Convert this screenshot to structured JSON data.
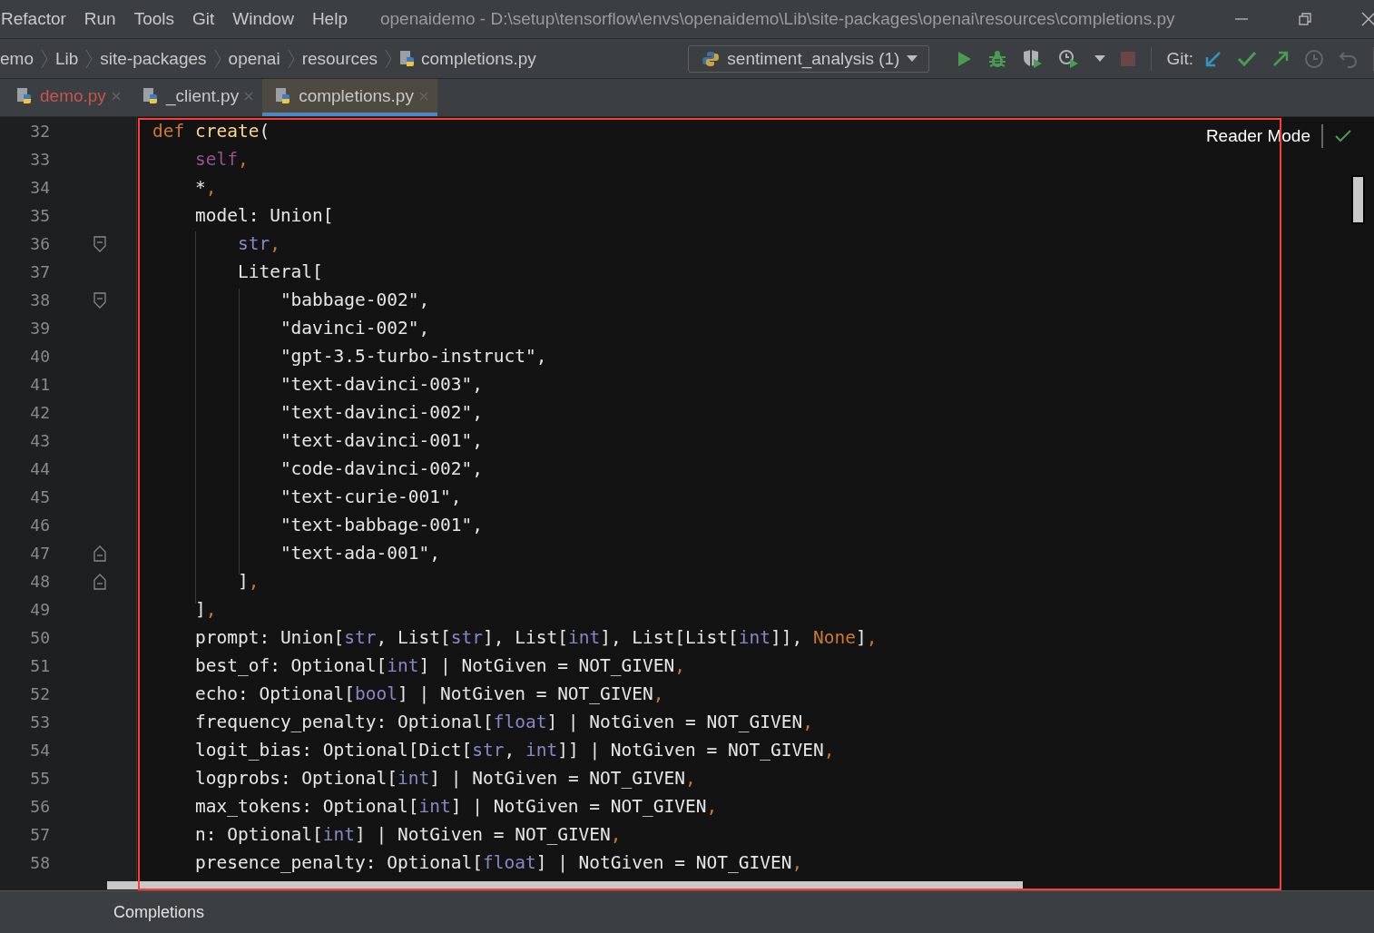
{
  "menu": [
    "Refactor",
    "Run",
    "Tools",
    "Git",
    "Window",
    "Help"
  ],
  "window": {
    "title": "openaidemo - D:\\setup\\tensorflow\\envs\\openaidemo\\Lib\\site-packages\\openai\\resources\\completions.py"
  },
  "breadcrumbs": [
    "emo",
    "Lib",
    "site-packages",
    "openai",
    "resources",
    "completions.py"
  ],
  "run_config": "sentiment_analysis (1)",
  "toolbar": [
    {
      "kind": "run",
      "disabled": false
    },
    {
      "kind": "debug",
      "disabled": false
    },
    {
      "kind": "coverage",
      "disabled": false
    },
    {
      "kind": "profile",
      "disabled": false
    },
    {
      "kind": "stop",
      "disabled": true
    }
  ],
  "git": {
    "label": "Git:",
    "buttons": [
      {
        "kind": "update",
        "disabled": false
      },
      {
        "kind": "commit",
        "disabled": false
      },
      {
        "kind": "push",
        "disabled": false
      },
      {
        "kind": "history",
        "disabled": true
      },
      {
        "kind": "rollback",
        "disabled": true
      }
    ]
  },
  "tabs": [
    {
      "label": "demo.py",
      "selected": false,
      "has_errors": true
    },
    {
      "label": "_client.py",
      "selected": false,
      "has_errors": false
    },
    {
      "label": "completions.py",
      "selected": true,
      "has_errors": false
    }
  ],
  "reader_mode": "Reader Mode",
  "lines": [
    {
      "n": "32",
      "fold_start": false,
      "fold_end": false,
      "tokens": [
        {
          "kind": "kw",
          "text": "def"
        },
        {
          "kind": "fn",
          "text": " create"
        },
        {
          "kind": "p",
          "text": "("
        }
      ]
    },
    {
      "n": "33",
      "fold_start": false,
      "fold_end": false,
      "tokens": [
        {
          "kind": "self",
          "text": "    self"
        },
        {
          "kind": "kw",
          "text": ","
        }
      ]
    },
    {
      "n": "34",
      "fold_start": false,
      "fold_end": false,
      "tokens": [
        {
          "kind": "p",
          "text": "    *"
        },
        {
          "kind": "kw",
          "text": ","
        }
      ]
    },
    {
      "n": "35",
      "fold_start": false,
      "fold_end": false,
      "tokens": [
        {
          "kind": "p",
          "text": "    model: Union["
        }
      ]
    },
    {
      "n": "36",
      "fold_start": true,
      "fold_end": false,
      "tokens": [
        {
          "kind": "bi",
          "text": "        str"
        },
        {
          "kind": "kw",
          "text": ","
        }
      ]
    },
    {
      "n": "37",
      "fold_start": false,
      "fold_end": false,
      "tokens": [
        {
          "kind": "p",
          "text": "        Literal["
        }
      ]
    },
    {
      "n": "38",
      "fold_start": true,
      "fold_end": false,
      "tokens": [
        {
          "kind": "p",
          "text": "            \"babbage-002\","
        }
      ]
    },
    {
      "n": "39",
      "fold_start": false,
      "fold_end": false,
      "tokens": [
        {
          "kind": "p",
          "text": "            \"davinci-002\","
        }
      ]
    },
    {
      "n": "40",
      "fold_start": false,
      "fold_end": false,
      "tokens": [
        {
          "kind": "p",
          "text": "            \"gpt-3.5-turbo-instruct\","
        }
      ]
    },
    {
      "n": "41",
      "fold_start": false,
      "fold_end": false,
      "tokens": [
        {
          "kind": "p",
          "text": "            \"text-davinci-003\","
        }
      ]
    },
    {
      "n": "42",
      "fold_start": false,
      "fold_end": false,
      "tokens": [
        {
          "kind": "p",
          "text": "            \"text-davinci-002\","
        }
      ]
    },
    {
      "n": "43",
      "fold_start": false,
      "fold_end": false,
      "tokens": [
        {
          "kind": "p",
          "text": "            \"text-davinci-001\","
        }
      ]
    },
    {
      "n": "44",
      "fold_start": false,
      "fold_end": false,
      "tokens": [
        {
          "kind": "p",
          "text": "            \"code-davinci-002\","
        }
      ]
    },
    {
      "n": "45",
      "fold_start": false,
      "fold_end": false,
      "tokens": [
        {
          "kind": "p",
          "text": "            \"text-curie-001\","
        }
      ]
    },
    {
      "n": "46",
      "fold_start": false,
      "fold_end": false,
      "tokens": [
        {
          "kind": "p",
          "text": "            \"text-babbage-001\","
        }
      ]
    },
    {
      "n": "47",
      "fold_start": false,
      "fold_end": true,
      "tokens": [
        {
          "kind": "p",
          "text": "            \"text-ada-001\","
        }
      ]
    },
    {
      "n": "48",
      "fold_start": false,
      "fold_end": true,
      "tokens": [
        {
          "kind": "p",
          "text": "        ]"
        },
        {
          "kind": "kw",
          "text": ","
        }
      ]
    },
    {
      "n": "49",
      "fold_start": false,
      "fold_end": false,
      "tokens": [
        {
          "kind": "p",
          "text": "    ]"
        },
        {
          "kind": "kw",
          "text": ","
        }
      ]
    },
    {
      "n": "50",
      "fold_start": false,
      "fold_end": false,
      "tokens": [
        {
          "kind": "p",
          "text": "    prompt: Union["
        },
        {
          "kind": "bi",
          "text": "str"
        },
        {
          "kind": "p",
          "text": ", List["
        },
        {
          "kind": "bi",
          "text": "str"
        },
        {
          "kind": "p",
          "text": "], List["
        },
        {
          "kind": "bi",
          "text": "int"
        },
        {
          "kind": "p",
          "text": "], List[List["
        },
        {
          "kind": "bi",
          "text": "int"
        },
        {
          "kind": "p",
          "text": "]], "
        },
        {
          "kind": "kw",
          "text": "None"
        },
        {
          "kind": "p",
          "text": "]"
        },
        {
          "kind": "kw",
          "text": ","
        }
      ]
    },
    {
      "n": "51",
      "fold_start": false,
      "fold_end": false,
      "tokens": [
        {
          "kind": "p",
          "text": "    best_of: Optional["
        },
        {
          "kind": "bi",
          "text": "int"
        },
        {
          "kind": "p",
          "text": "] | NotGiven = NOT_GIVEN"
        },
        {
          "kind": "kw",
          "text": ","
        }
      ]
    },
    {
      "n": "52",
      "fold_start": false,
      "fold_end": false,
      "tokens": [
        {
          "kind": "p",
          "text": "    echo: Optional["
        },
        {
          "kind": "bi",
          "text": "bool"
        },
        {
          "kind": "p",
          "text": "] | NotGiven = NOT_GIVEN"
        },
        {
          "kind": "kw",
          "text": ","
        }
      ]
    },
    {
      "n": "53",
      "fold_start": false,
      "fold_end": false,
      "tokens": [
        {
          "kind": "p",
          "text": "    frequency_penalty: Optional["
        },
        {
          "kind": "bi",
          "text": "float"
        },
        {
          "kind": "p",
          "text": "] | NotGiven = NOT_GIVEN"
        },
        {
          "kind": "kw",
          "text": ","
        }
      ]
    },
    {
      "n": "54",
      "fold_start": false,
      "fold_end": false,
      "tokens": [
        {
          "kind": "p",
          "text": "    logit_bias: Optional[Dict["
        },
        {
          "kind": "bi",
          "text": "str"
        },
        {
          "kind": "p",
          "text": ", "
        },
        {
          "kind": "bi",
          "text": "int"
        },
        {
          "kind": "p",
          "text": "]] | NotGiven = NOT_GIVEN"
        },
        {
          "kind": "kw",
          "text": ","
        }
      ]
    },
    {
      "n": "55",
      "fold_start": false,
      "fold_end": false,
      "tokens": [
        {
          "kind": "p",
          "text": "    logprobs: Optional["
        },
        {
          "kind": "bi",
          "text": "int"
        },
        {
          "kind": "p",
          "text": "] | NotGiven = NOT_GIVEN"
        },
        {
          "kind": "kw",
          "text": ","
        }
      ]
    },
    {
      "n": "56",
      "fold_start": false,
      "fold_end": false,
      "tokens": [
        {
          "kind": "p",
          "text": "    max_tokens: Optional["
        },
        {
          "kind": "bi",
          "text": "int"
        },
        {
          "kind": "p",
          "text": "] | NotGiven = NOT_GIVEN"
        },
        {
          "kind": "kw",
          "text": ","
        }
      ]
    },
    {
      "n": "57",
      "fold_start": false,
      "fold_end": false,
      "tokens": [
        {
          "kind": "p",
          "text": "    n: Optional["
        },
        {
          "kind": "bi",
          "text": "int"
        },
        {
          "kind": "p",
          "text": "] | NotGiven = NOT_GIVEN"
        },
        {
          "kind": "kw",
          "text": ","
        }
      ]
    },
    {
      "n": "58",
      "fold_start": false,
      "fold_end": false,
      "tokens": [
        {
          "kind": "p",
          "text": "    presence_penalty: Optional["
        },
        {
          "kind": "bi",
          "text": "float"
        },
        {
          "kind": "p",
          "text": "] | NotGiven = NOT_GIVEN"
        },
        {
          "kind": "kw",
          "text": ","
        }
      ]
    }
  ],
  "status_breadcrumb": "Completions"
}
